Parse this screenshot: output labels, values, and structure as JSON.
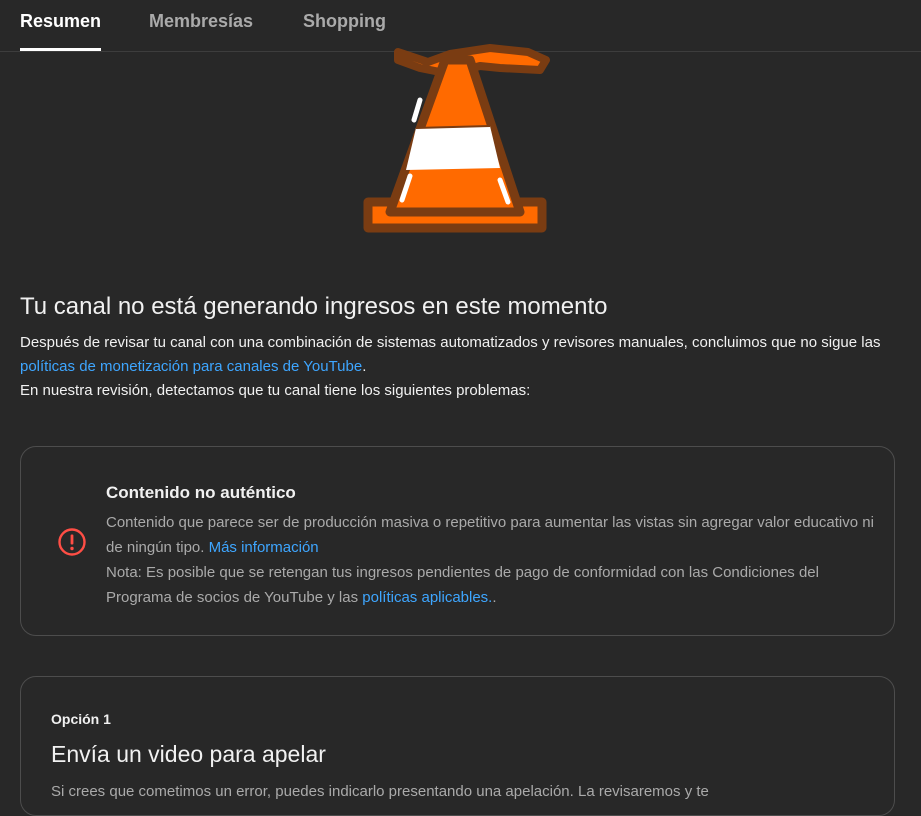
{
  "tabs": [
    {
      "label": "Resumen",
      "active": true
    },
    {
      "label": "Membresías",
      "active": false
    },
    {
      "label": "Shopping",
      "active": false
    }
  ],
  "illustration": {
    "icon": "traffic-cone-icon",
    "colors": {
      "orange": "#ff6a00",
      "outline": "#7a3c12",
      "stripe": "#ffffff"
    }
  },
  "status": {
    "title": "Tu canal no está generando ingresos en este momento",
    "para1_before": "Después de revisar tu canal con una combinación de sistemas automatizados y revisores manuales, concluimos que no sigue las ",
    "para1_link": "políticas de monetización para canales de YouTube",
    "para1_after": ".",
    "para2": "En nuestra revisión, detectamos que tu canal tiene los siguientes problemas:"
  },
  "issue": {
    "icon": "error-icon",
    "icon_color": "#ff4e45",
    "title": "Contenido no auténtico",
    "desc": "Contenido que parece ser de producción masiva o repetitivo para aumentar las vistas sin agregar valor educativo ni de ningún tipo.",
    "more_link": "Más información",
    "note": "Nota: Es posible que se retengan tus ingresos pendientes de pago de conformidad con las Condiciones del Programa de socios de YouTube y las ",
    "note_link": "políticas aplicables.",
    "note_after": "."
  },
  "appeal": {
    "label": "Opción 1",
    "title": "Envía un video para apelar",
    "desc": "Si crees que cometimos un error, puedes indicarlo presentando una apelación. La revisaremos y te"
  },
  "colors": {
    "background": "#282828",
    "link": "#3ea6ff",
    "muted_text": "#aaaaaa",
    "border": "#4d4d4d"
  }
}
